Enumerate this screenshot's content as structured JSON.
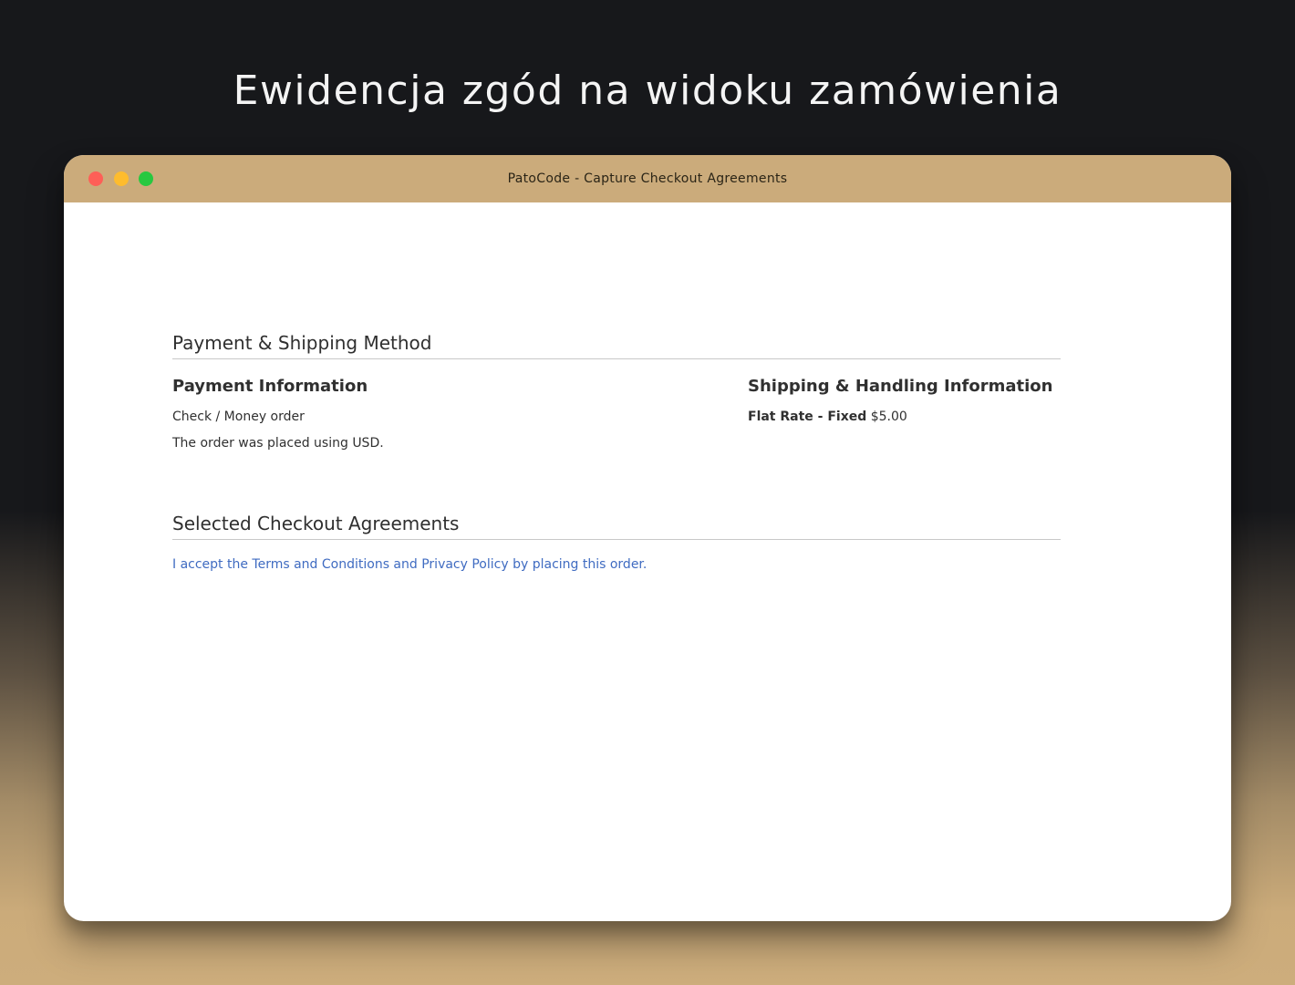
{
  "hero": {
    "title": "Ewidencja zgód na widoku zamówienia"
  },
  "window": {
    "title": "PatoCode - Capture Checkout Agreements",
    "controls": {
      "close_color": "#fe5f57",
      "minimize_color": "#febc2e",
      "maximize_color": "#28c840"
    },
    "titlebar_color": "#cbab7b"
  },
  "order_view": {
    "payment_shipping_section": {
      "title": "Payment & Shipping Method",
      "payment": {
        "title": "Payment Information",
        "method": "Check / Money order",
        "currency_note": "The order was placed using USD."
      },
      "shipping": {
        "title": "Shipping & Handling Information",
        "method_label": "Flat Rate - Fixed",
        "price": "$5.00"
      }
    },
    "agreements_section": {
      "title": "Selected Checkout Agreements",
      "agreement_text": "I accept the Terms and Conditions and Privacy Policy by placing this order.",
      "link_color": "#3f6bc1"
    }
  }
}
